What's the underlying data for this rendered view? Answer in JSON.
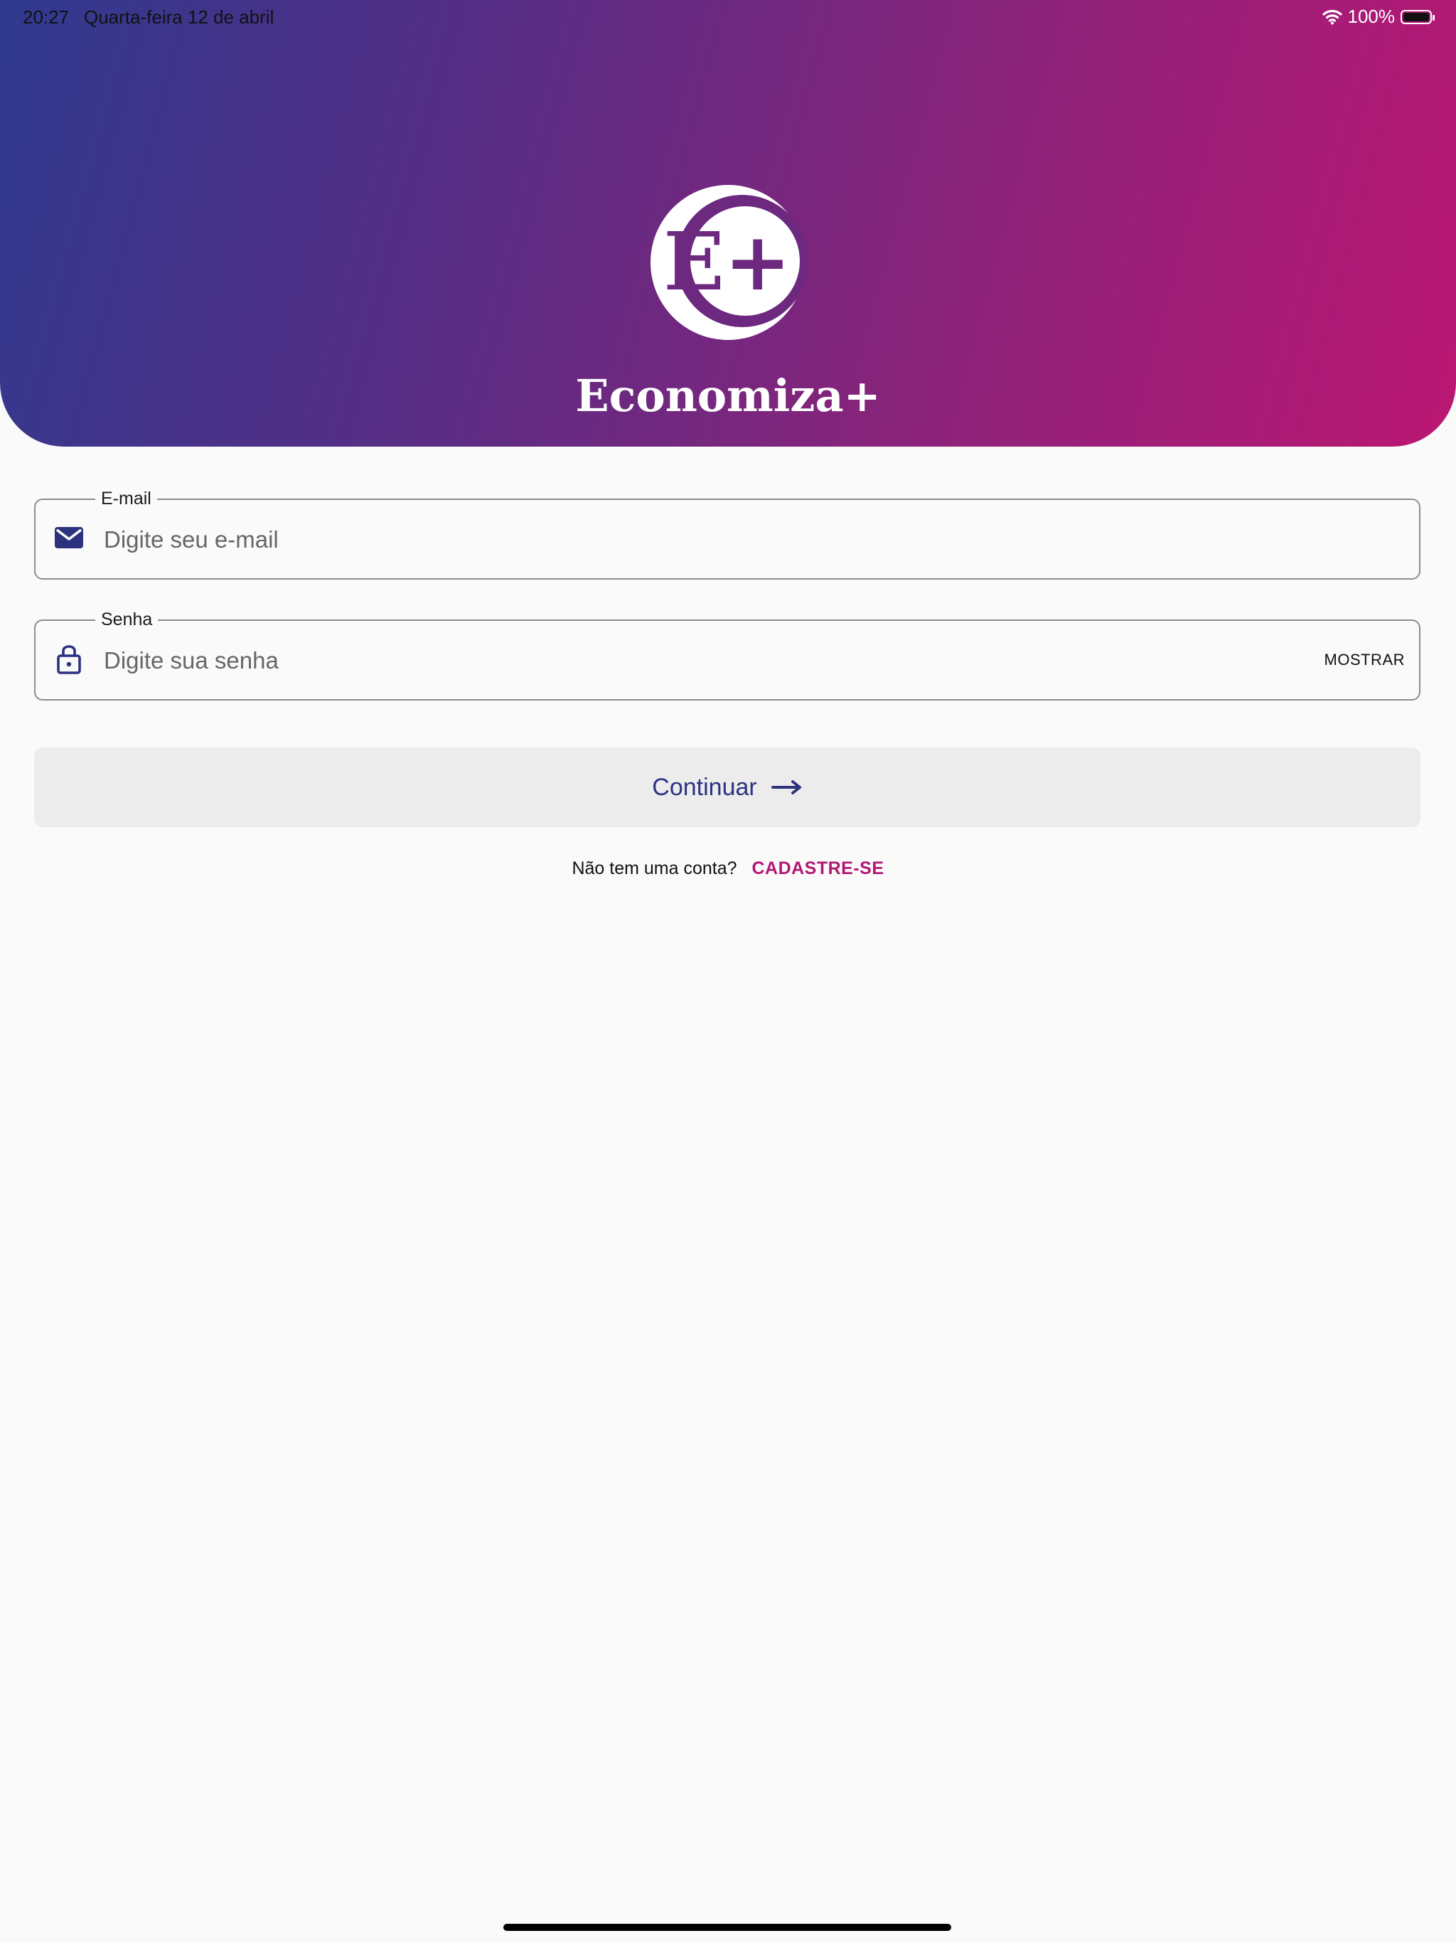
{
  "status_bar": {
    "time": "20:27",
    "date": "Quarta-feira 12 de abril",
    "battery": "100%",
    "wifi_icon": "wifi-icon",
    "battery_icon": "battery-icon"
  },
  "header": {
    "logo_icon": "e-plus-logo-icon",
    "logo_text": "E+",
    "app_name": "Economiza+",
    "gradient_colors": [
      "#2f3a8f",
      "#bb1773"
    ]
  },
  "form": {
    "email": {
      "label": "E-mail",
      "placeholder": "Digite seu e-mail",
      "icon": "mail-icon"
    },
    "password": {
      "label": "Senha",
      "placeholder": "Digite sua senha",
      "icon": "lock-icon",
      "show_label": "MOSTRAR"
    },
    "continue": {
      "label": "Continuar",
      "icon": "arrow-right-icon"
    },
    "signup": {
      "prompt": "Não tem uma conta?",
      "link": "CADASTRE-SE",
      "link_color": "#b11874"
    }
  },
  "colors": {
    "accent": "#2d327f",
    "background": "#fafafa",
    "button_background": "#ececec"
  }
}
